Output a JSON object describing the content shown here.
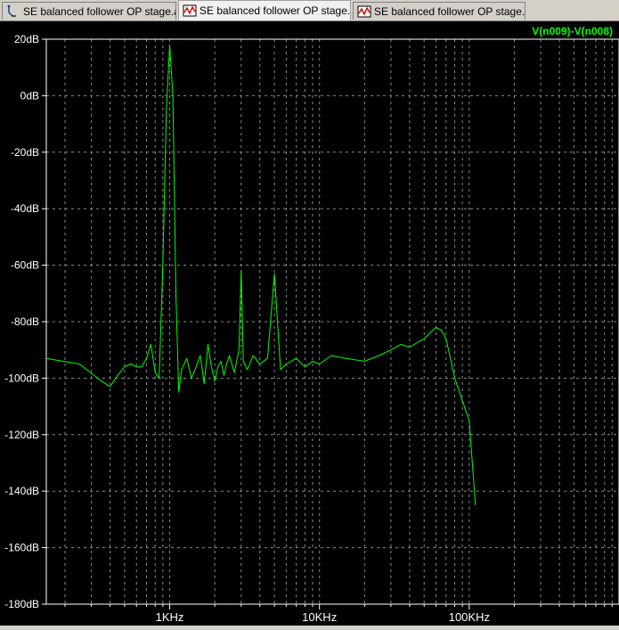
{
  "tabs": [
    {
      "label": "SE balanced follower OP stage.asc",
      "icon": "schematic-icon",
      "active": false
    },
    {
      "label": "SE balanced follower OP stage.fft",
      "icon": "waveform-icon",
      "active": true
    },
    {
      "label": "SE balanced follower OP stage.raw",
      "icon": "waveform-icon",
      "active": false
    }
  ],
  "colors": {
    "trace": "#00ff00",
    "grid": "#8a8a8a",
    "axis_text": "#ffffff",
    "background": "#000000"
  },
  "chart_data": {
    "type": "line",
    "title": "",
    "trace_label": "V(n009)-V(n008)",
    "x_scale": "log",
    "xlim": [
      150,
      1000000
    ],
    "x_ticks": [
      1000,
      10000,
      100000
    ],
    "x_tick_labels": [
      "1KHz",
      "10KHz",
      "100KHz"
    ],
    "ylim": [
      -180,
      20
    ],
    "y_ticks": [
      20,
      0,
      -20,
      -40,
      -60,
      -80,
      -100,
      -120,
      -140,
      -160,
      -180
    ],
    "y_tick_labels": [
      "20dB",
      "0dB",
      "-20dB",
      "-40dB",
      "-60dB",
      "-80dB",
      "-100dB",
      "-120dB",
      "-140dB",
      "-160dB",
      "-180dB"
    ],
    "grid": true,
    "series": [
      {
        "name": "V(n009)-V(n008)",
        "unit_x": "Hz",
        "unit_y": "dB",
        "x": [
          150,
          250,
          350,
          400,
          450,
          500,
          550,
          600,
          650,
          700,
          750,
          800,
          850,
          900,
          950,
          1000,
          1050,
          1100,
          1150,
          1200,
          1300,
          1400,
          1500,
          1600,
          1700,
          1800,
          1900,
          2000,
          2100,
          2200,
          2300,
          2400,
          2500,
          2700,
          2900,
          3000,
          3100,
          3300,
          3600,
          4000,
          4500,
          5000,
          5500,
          6000,
          7000,
          8000,
          9000,
          10000,
          12000,
          15000,
          20000,
          25000,
          30000,
          35000,
          40000,
          50000,
          60000,
          65000,
          70000,
          80000,
          90000,
          100000,
          110000
        ],
        "y": [
          -93,
          -95,
          -101,
          -103,
          -99,
          -96,
          -95,
          -96,
          -96,
          -93,
          -88,
          -98,
          -100,
          -60,
          -5,
          18,
          0,
          -70,
          -105,
          -97,
          -93,
          -100,
          -96,
          -92,
          -102,
          -88,
          -96,
          -101,
          -96,
          -94,
          -99,
          -95,
          -92,
          -98,
          -90,
          -62,
          -94,
          -97,
          -92,
          -95,
          -93,
          -63,
          -97,
          -95,
          -93,
          -96,
          -94,
          -95,
          -92,
          -93,
          -94,
          -92,
          -90,
          -88,
          -89,
          -86,
          -82,
          -83,
          -86,
          -100,
          -108,
          -115,
          -145
        ]
      }
    ]
  }
}
